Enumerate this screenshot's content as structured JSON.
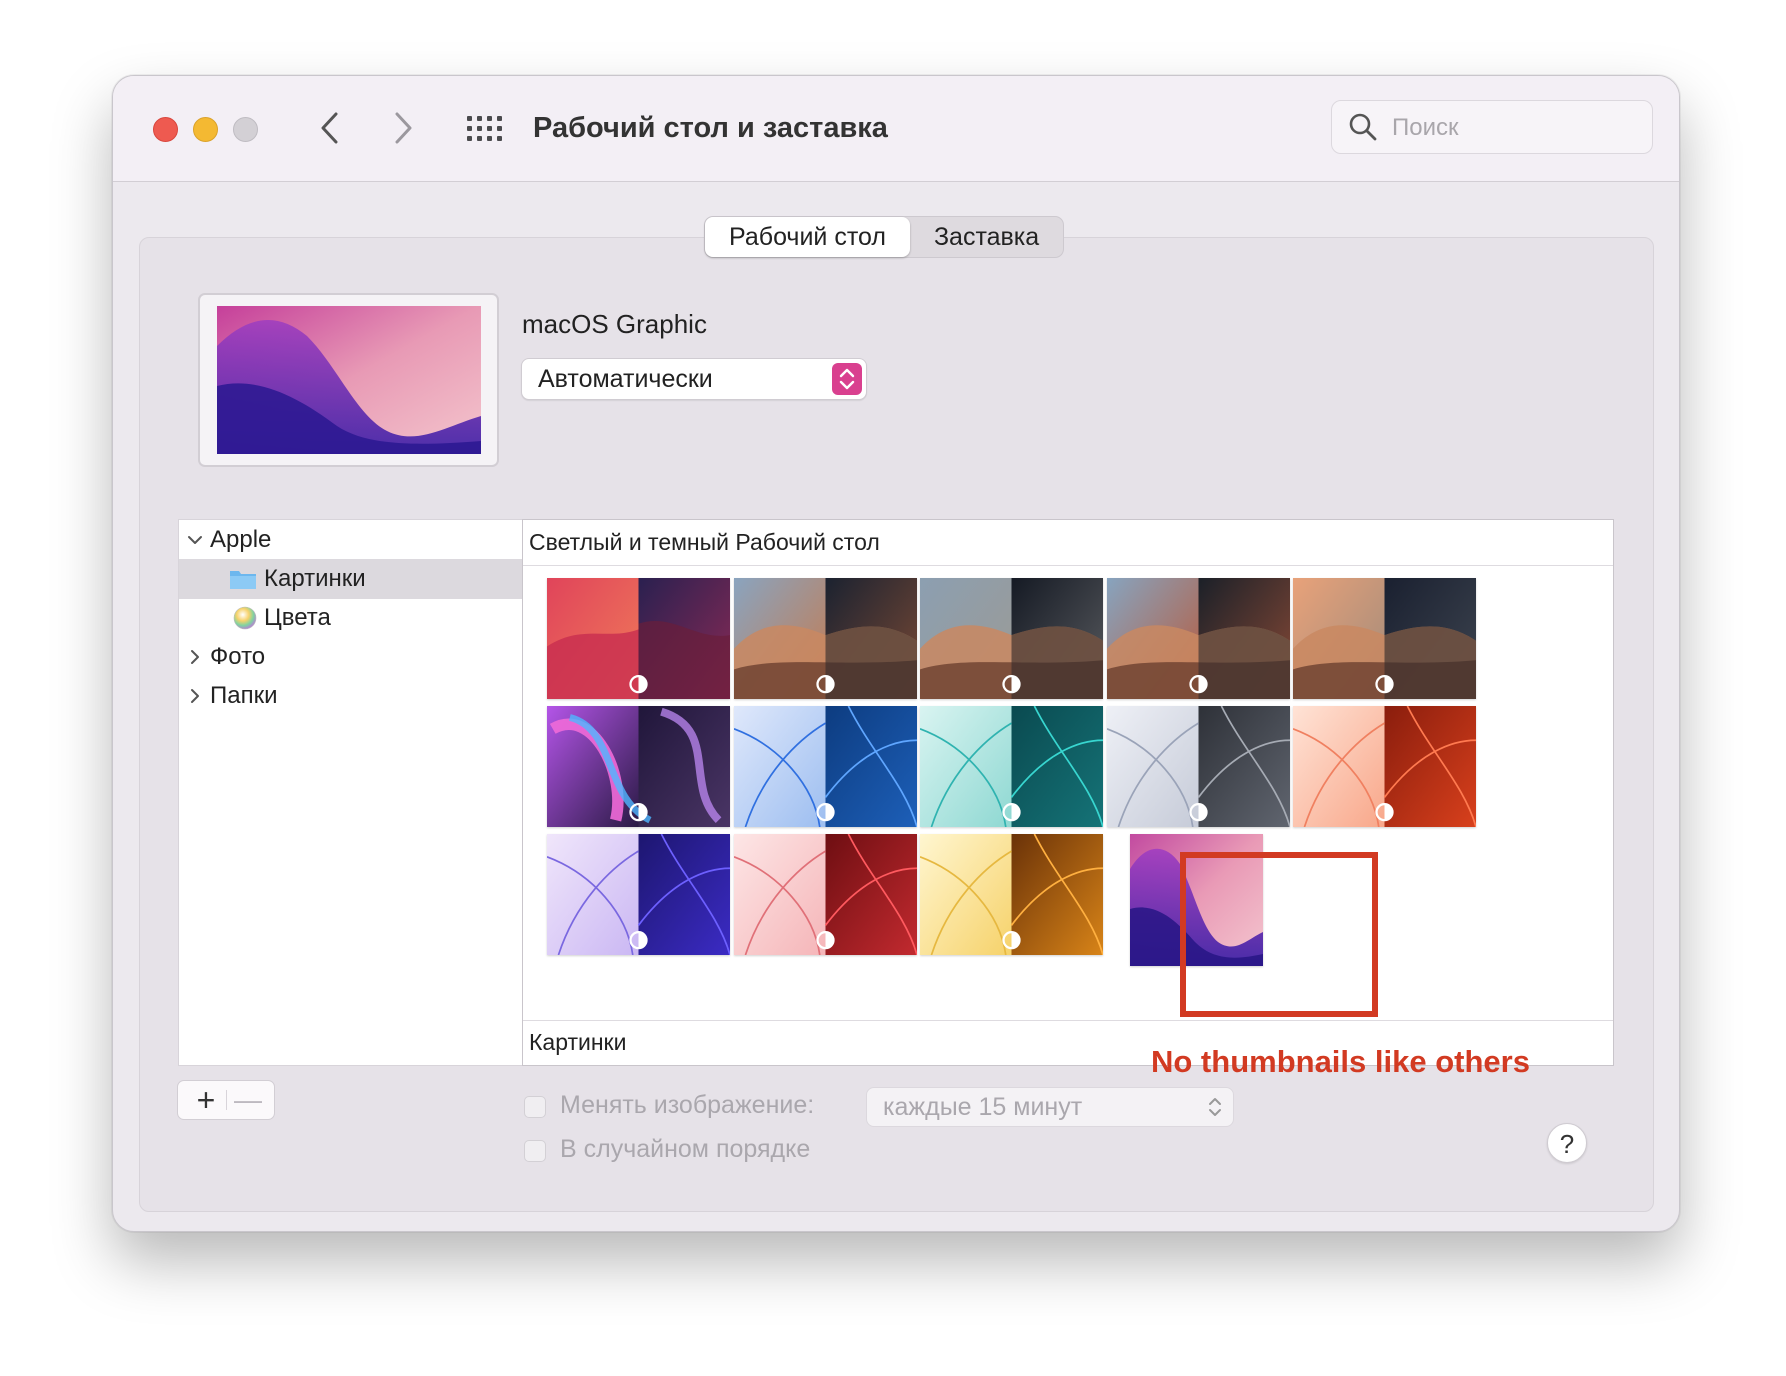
{
  "window": {
    "title": "Рабочий стол и заставка",
    "search_placeholder": "Поиск"
  },
  "tabs": [
    {
      "label": "Рабочий стол",
      "active": true
    },
    {
      "label": "Заставка",
      "active": false
    }
  ],
  "current": {
    "wallpaper_name": "macOS Graphic",
    "mode_label": "Автоматически"
  },
  "sidebar": {
    "items": [
      {
        "label": "Apple",
        "expanded": true
      },
      {
        "label": "Картинки",
        "selected": true
      },
      {
        "label": "Цвета"
      },
      {
        "label": "Фото"
      },
      {
        "label": "Папки"
      }
    ]
  },
  "grid": {
    "section_title": "Светлый и темный Рабочий стол",
    "bottom_section_title": "Картинки"
  },
  "annotation": {
    "text": "No thumbnails like others",
    "color": "#d23a22"
  },
  "controls": {
    "plus_label": "+",
    "minus_label": "—",
    "change_label": "Менять изображение:",
    "interval_label": "каждые 15 минут",
    "random_label": "В случайном порядке",
    "help_label": "?"
  }
}
